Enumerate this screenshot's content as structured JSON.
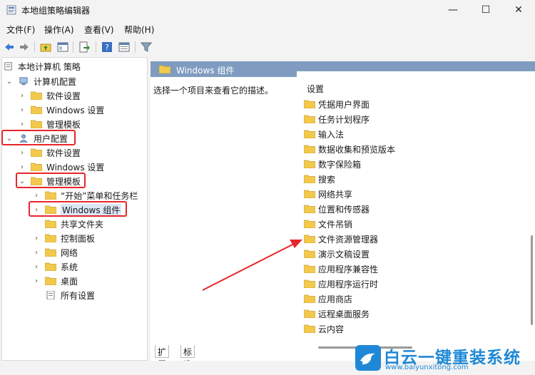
{
  "window": {
    "title": "本地组策略编辑器",
    "controls": {
      "minimize": "—",
      "maximize": "☐",
      "close": "✕"
    }
  },
  "menu": [
    "文件(F)",
    "操作(A)",
    "查看(V)",
    "帮助(H)"
  ],
  "toolbar": {
    "icons": [
      "back-arrow-icon",
      "forward-arrow-icon",
      "folder-up-icon",
      "show-hide-tree-icon",
      "export-list-icon",
      "help-icon",
      "properties-icon",
      "filter-icon"
    ]
  },
  "tree": {
    "root": "本地计算机 策略",
    "computer_config": "计算机配置",
    "computer_children": [
      "软件设置",
      "Windows 设置",
      "管理模板"
    ],
    "user_config": "用户配置",
    "user_children": [
      "软件设置",
      "Windows 设置",
      "管理模板"
    ],
    "admin_templates_children": [
      "“开始”菜单和任务栏",
      "Windows 组件",
      "共享文件夹",
      "控制面板",
      "网络",
      "系统",
      "桌面",
      "所有设置"
    ]
  },
  "right": {
    "header": "Windows 组件",
    "description": "选择一个项目来查看它的描述。",
    "column_header": "设置",
    "items": [
      "凭据用户界面",
      "任务计划程序",
      "输入法",
      "数据收集和预览版本",
      "数字保险箱",
      "搜索",
      "网络共享",
      "位置和传感器",
      "文件吊销",
      "文件资源管理器",
      "演示文稿设置",
      "应用程序兼容性",
      "应用程序运行时",
      "应用商店",
      "远程桌面服务",
      "云内容"
    ]
  },
  "tabs": [
    "扩展",
    "标准"
  ],
  "watermark": {
    "title": "白云一键重装系统",
    "url": "www.baiyunxitong.com"
  },
  "colors": {
    "highlight_box": "#e8262b",
    "header_bar": "#7f9cc0",
    "folder": "#f2c94c",
    "brand": "#1e88d6"
  }
}
